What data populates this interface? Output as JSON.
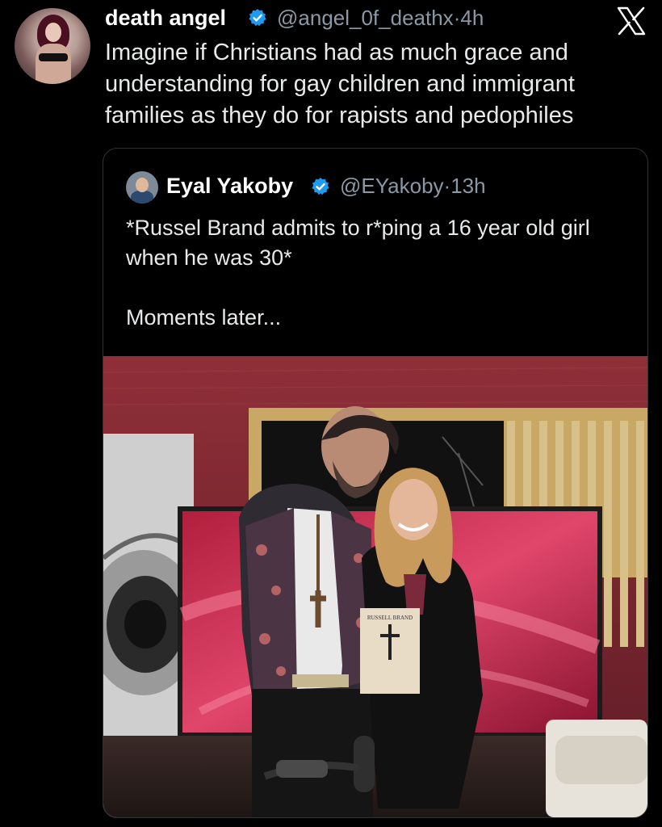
{
  "post": {
    "author_name": "death angel",
    "handle": "@angel_0f_deathx",
    "time": "4h",
    "text": "Imagine if Christians had as much grace and understanding for gay children and immigrant families as they do for rapists and pedophiles",
    "platform_logo": "X"
  },
  "quoted": {
    "author_name": "Eyal Yakoby",
    "handle": "@EYakoby",
    "time": "13h",
    "text": "*Russel Brand admits to r*ping a 16 year old girl when he was 30*\n\nMoments later...",
    "book_cover_text": "RUSSELL BRAND"
  },
  "colors": {
    "background": "#000000",
    "text": "#e7e9ea",
    "muted": "#8b98a5",
    "verified": "#1d9bf0",
    "border": "#2f3336"
  },
  "icons": [
    "verified-badge-icon",
    "x-logo-icon"
  ]
}
